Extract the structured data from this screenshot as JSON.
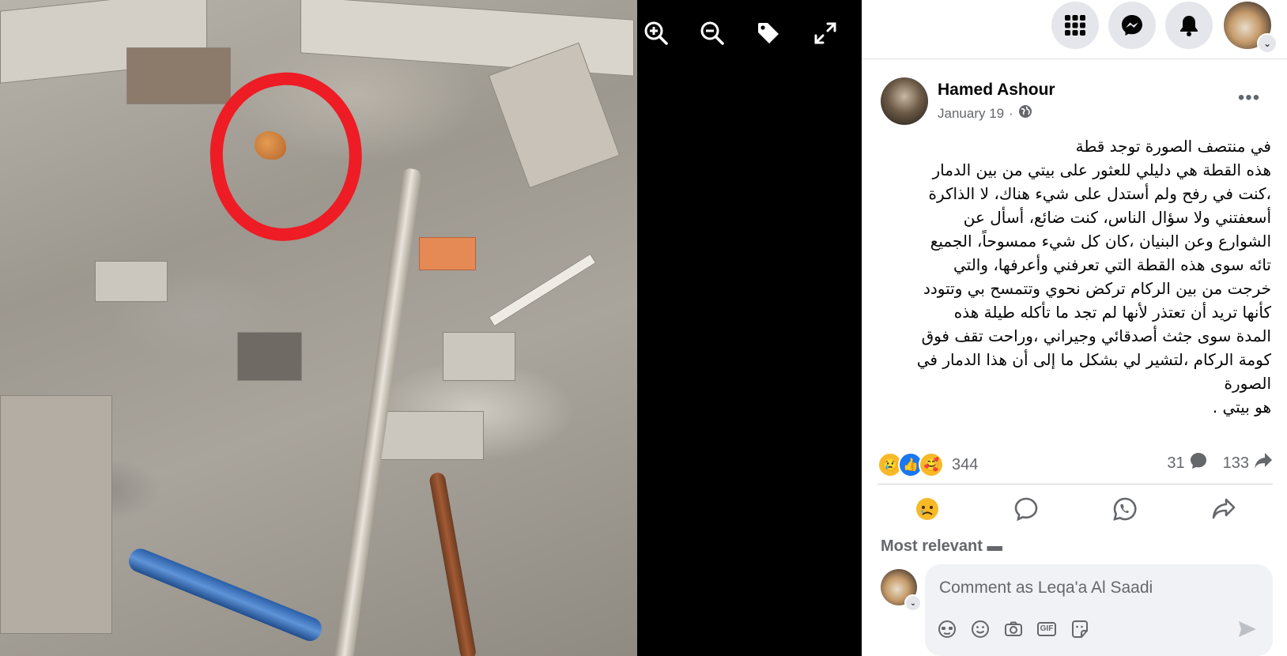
{
  "viewer": {
    "photo_alt": "",
    "tools": [
      {
        "name": "zoom-in-icon"
      },
      {
        "name": "zoom-out-icon"
      },
      {
        "name": "tag-icon"
      },
      {
        "name": "fullscreen-icon"
      }
    ]
  },
  "topbar": {
    "buttons": [
      "menu-grid-icon",
      "messenger-icon",
      "notifications-bell-icon"
    ],
    "avatar_chevron": "⌄"
  },
  "post": {
    "author": "Hamed Ashour",
    "date": "January 19",
    "separator": "·",
    "more": "•••",
    "lines": [
      "في منتصف الصورة توجد قطة",
      "هذه القطة هي دليلي للعثور على بيتي من بين الدمار",
      "،كنت في رفح ولم أستدل على شيء هناك، لا الذاكرة",
      "أسعفتني ولا سؤال الناس، كنت ضائع، أسأل عن",
      "الشوارع وعن البنيان ،كان كل شيء ممسوحاً، الجميع",
      "تائه سوى هذه القطة التي تعرفني وأعرفها، والتي",
      "خرجت من بين الركام تركض نحوي وتتمسح بي وتتودد",
      "كأنها تريد أن تعتذر لأنها لم تجد ما تأكله طيلة هذه",
      "المدة سوى جثث أصدقائي وجيراني ،وراحت تقف فوق",
      "كومة الركام ،لتشير لي بشكل ما إلى أن هذا الدمار في",
      "الصورة",
      "هو بيتي ."
    ],
    "reactions": {
      "icons": [
        "😢",
        "👍",
        "🥰"
      ],
      "count": "344"
    },
    "comments_count": "31",
    "shares_count": "133",
    "most_relevant": "Most relevant ▬"
  },
  "comment": {
    "placeholder": "Comment as Leqa'a Al Saadi",
    "gif_label": "GIF"
  }
}
